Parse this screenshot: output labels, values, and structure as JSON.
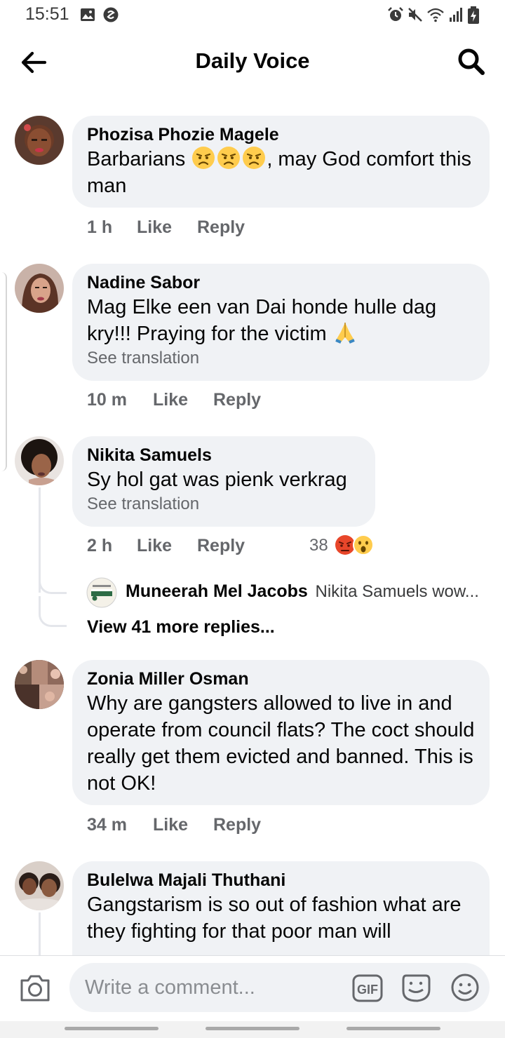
{
  "status_bar": {
    "time": "15:51"
  },
  "header": {
    "title": "Daily Voice"
  },
  "comments": [
    {
      "name": "Phozisa Phozie Magele",
      "text_before_emoji": "Barbarians",
      "text_after_emoji": ", may God comfort this man",
      "emojis": [
        "angry-face-emoji",
        "angry-face-emoji",
        "angry-face-emoji"
      ],
      "time": "1 h",
      "like": "Like",
      "reply": "Reply"
    },
    {
      "name": "Nadine Sabor",
      "text": "Mag Elke een van Dai honde hulle dag kry!!! Praying for the victim",
      "emojis": [
        "folded-hands-emoji"
      ],
      "see_translation": "See translation",
      "time": "10 m",
      "like": "Like",
      "reply": "Reply"
    },
    {
      "name": "Nikita Samuels",
      "text": "Sy hol gat was pienk verkrag",
      "see_translation": "See translation",
      "time": "2 h",
      "like": "Like",
      "reply": "Reply",
      "reaction_count": "38",
      "reactions": [
        "angry-reaction-icon",
        "wow-reaction-icon"
      ],
      "reply_preview": {
        "name": "Muneerah Mel Jacobs",
        "text": "Nikita Samuels wow..."
      },
      "view_more": "View 41 more replies..."
    },
    {
      "name": "Zonia Miller Osman",
      "text": "Why are gangsters allowed to live in and operate from council flats? The coct should really get them evicted and banned. This is not OK!",
      "time": "34 m",
      "like": "Like",
      "reply": "Reply"
    },
    {
      "name": "Bulelwa Majali Thuthani",
      "text": "Gangstarism is so out of fashion what are they fighting for that poor man will"
    }
  ],
  "composer": {
    "placeholder": "Write a comment...",
    "icons": [
      "camera-icon",
      "gif-icon",
      "sticker-icon",
      "emoji-icon"
    ]
  },
  "colors": {
    "bubble": "#f0f2f5",
    "secondary_text": "#65676b",
    "angry": "#e8462a",
    "emoji_yellow": "#ffcc4d"
  }
}
